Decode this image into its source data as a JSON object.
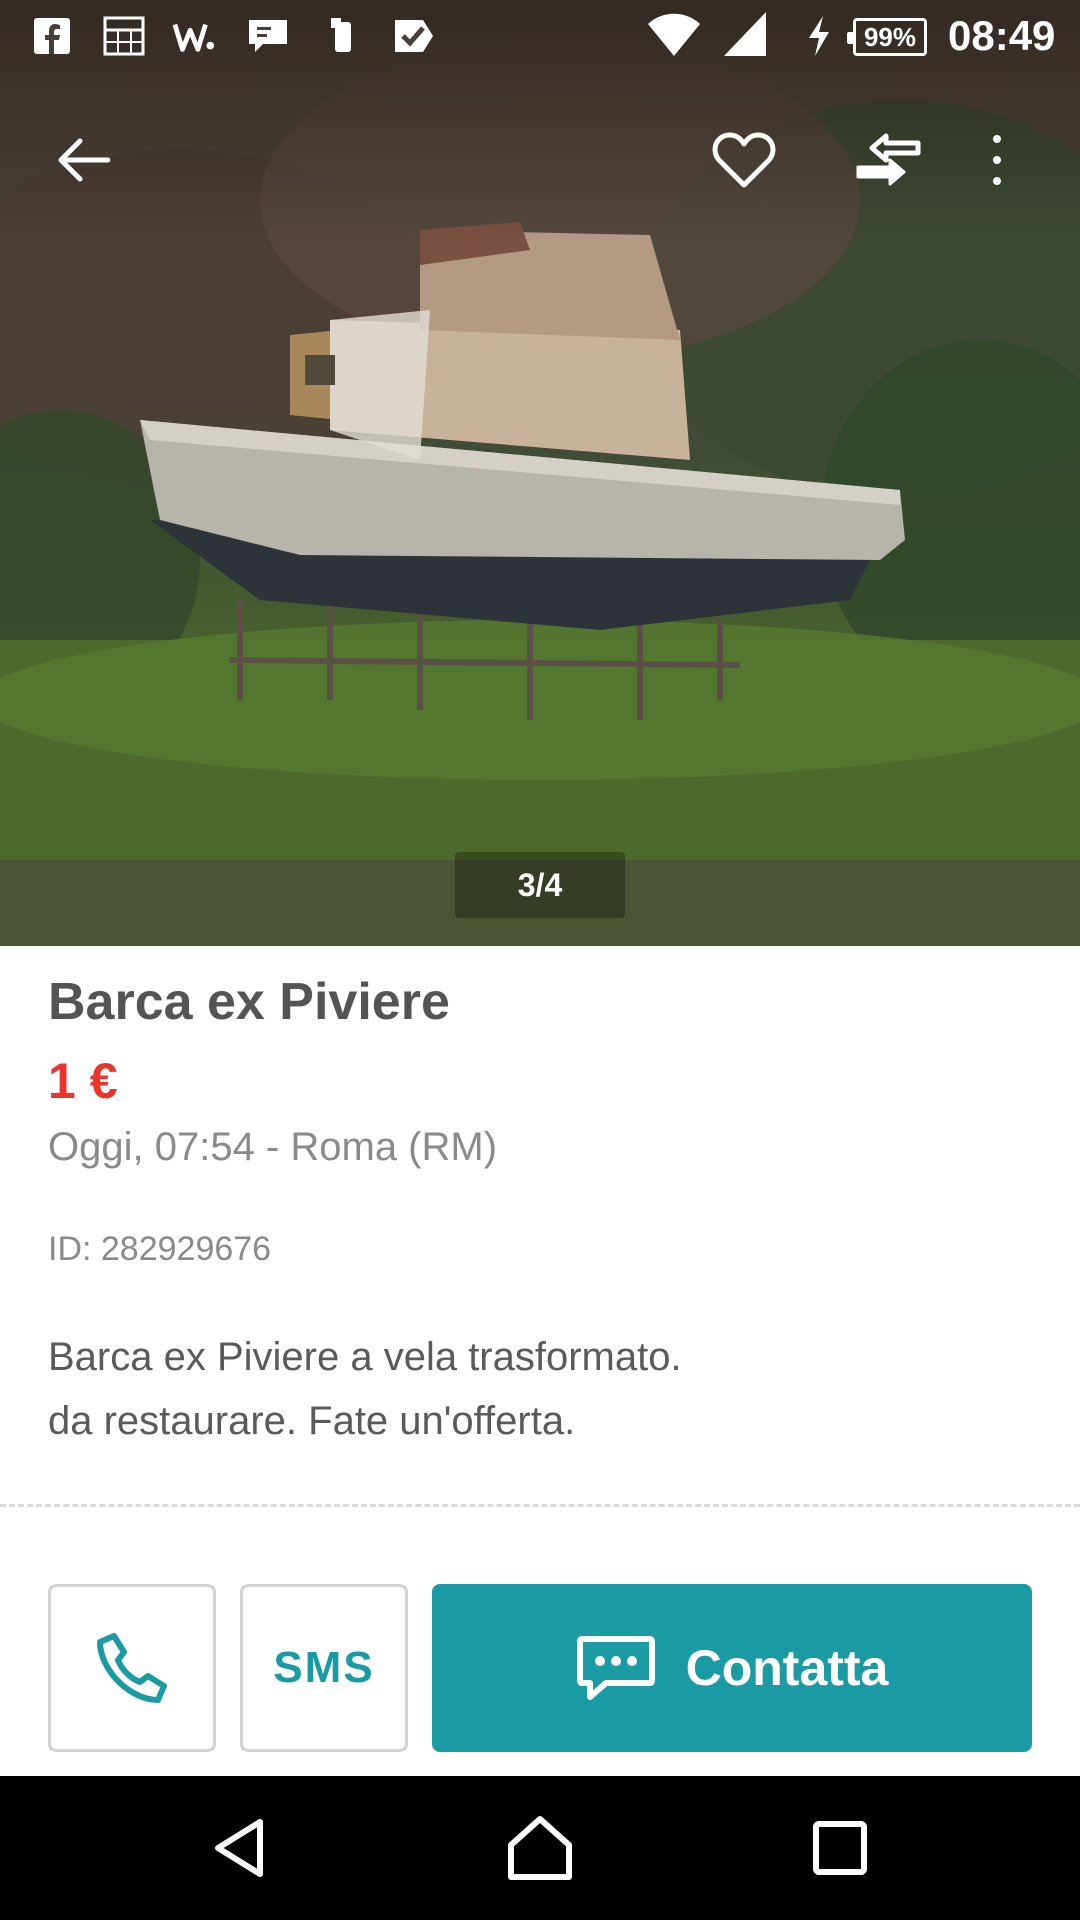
{
  "status_bar": {
    "notification_icons": [
      "facebook-icon",
      "calendar-grid-icon",
      "w-app-icon",
      "message-icon",
      "phone-device-icon",
      "check-icon"
    ],
    "signal_icons": [
      "wifi-icon",
      "cellular-signal-icon",
      "charging-icon"
    ],
    "battery": "99%",
    "time": "08:49"
  },
  "toolbar": {
    "back_icon": "arrow-left-icon",
    "favorite_icon": "heart-icon",
    "compare_icon": "swap-arrows-icon",
    "more_icon": "more-vertical-icon"
  },
  "gallery": {
    "counter": "3/4"
  },
  "listing": {
    "title": "Barca ex Piviere",
    "price": "1 €",
    "meta": "Oggi, 07:54 - Roma (RM)",
    "id_text": "ID: 282929676",
    "description": "Barca ex Piviere a vela trasformato.\n da restaurare. Fate un'offerta."
  },
  "actions": {
    "call_icon": "phone-icon",
    "sms_label": "SMS",
    "contact_label": "Contatta",
    "contact_icon": "chat-bubble-icon"
  },
  "colors": {
    "accent": "#1a9aa3",
    "price": "#e8362c",
    "title": "#545454",
    "muted": "#8a8a8a"
  },
  "navigation": {
    "back": "nav-back-icon",
    "home": "nav-home-icon",
    "recents": "nav-recents-icon"
  }
}
